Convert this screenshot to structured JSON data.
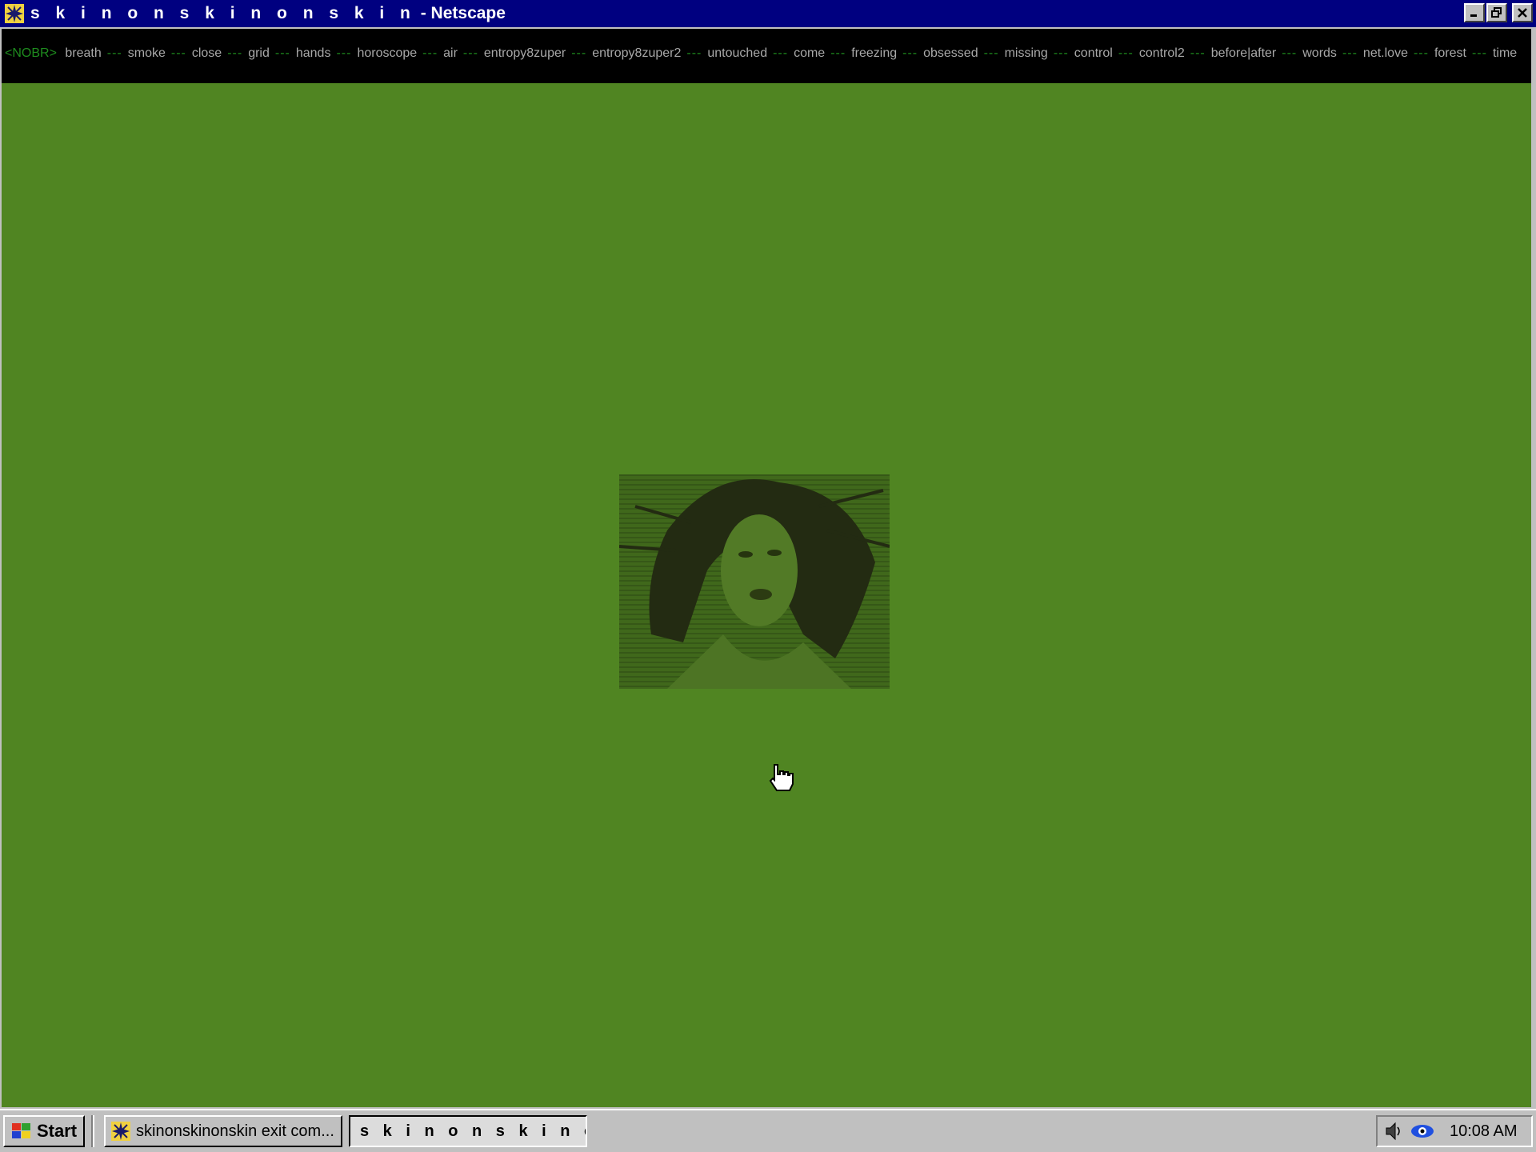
{
  "window": {
    "title_spaced": "s k i n o n s k i n o n s k i n",
    "title_suffix": " - Netscape",
    "controls": {
      "minimize": "minimize",
      "restore": "restore",
      "close": "close"
    }
  },
  "linkbar": {
    "tag": "<NOBR>",
    "separator": "---",
    "links": [
      "breath",
      "smoke",
      "close",
      "grid",
      "hands",
      "horoscope",
      "air",
      "entropy8zuper",
      "entropy8zuper2",
      "untouched",
      "come",
      "freezing",
      "obsessed",
      "missing",
      "control",
      "control2",
      "before|after",
      "words",
      "net.love",
      "forest",
      "time"
    ]
  },
  "colors": {
    "content_background": "#508522",
    "linkbar_background": "#000000",
    "tag_color": "#1e8c1e",
    "titlebar": "#000080"
  },
  "content": {
    "photo_icon": "portrait-photo"
  },
  "taskbar": {
    "start_label": "Start",
    "tasks": [
      {
        "label": "skinonskinonskin exit com...",
        "active": false
      },
      {
        "label": "s k i n o n s k i n o n ...",
        "active": true
      }
    ],
    "tray_icons": [
      "speaker-icon",
      "network-eye-icon"
    ],
    "clock": "10:08 AM"
  }
}
